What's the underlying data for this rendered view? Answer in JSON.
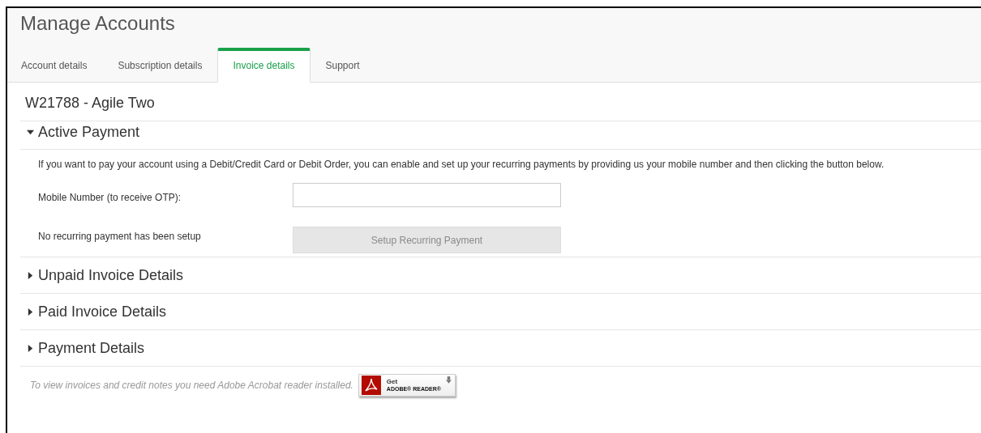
{
  "page_title": "Manage Accounts",
  "tabs": [
    {
      "label": "Account details",
      "selected": false
    },
    {
      "label": "Subscription details",
      "selected": false
    },
    {
      "label": "Invoice details",
      "selected": true
    },
    {
      "label": "Support",
      "selected": false
    }
  ],
  "account_heading": "W21788 - Agile Two",
  "sections": [
    {
      "title": "Active Payment",
      "expanded": true
    },
    {
      "title": "Unpaid Invoice Details",
      "expanded": false
    },
    {
      "title": "Paid Invoice Details",
      "expanded": false
    },
    {
      "title": "Payment Details",
      "expanded": false
    }
  ],
  "active_payment": {
    "intro": "If you want to pay your account using a Debit/Credit Card or Debit Order, you can enable and set up your recurring payments by providing us your mobile number and then clicking the button below.",
    "mobile_label": "Mobile Number (to receive OTP):",
    "status_text": "No recurring payment has been setup",
    "setup_button": {
      "label": "Setup Recurring Payment",
      "disabled": true
    }
  },
  "footer": {
    "note": "To view invoices and credit notes you need Adobe Acrobat reader installed.",
    "badge_line1": "Get",
    "badge_line2": "ADOBE® READER®"
  }
}
